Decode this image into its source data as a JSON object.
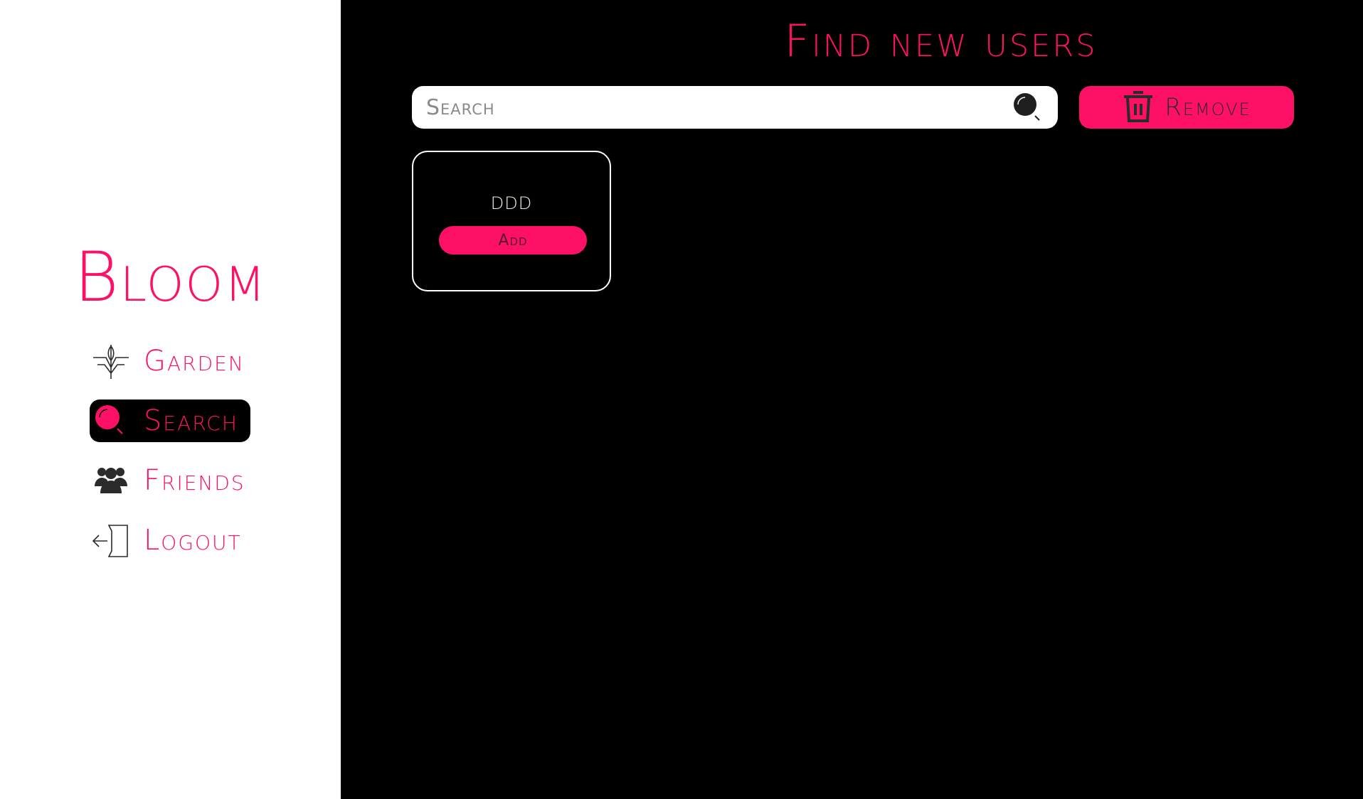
{
  "colors": {
    "accent": "#ff1067",
    "sidebar_bg": "#ffffff",
    "main_bg": "#000000",
    "icon_dark": "#2b2b2b"
  },
  "sidebar": {
    "brand": "Bloom",
    "items": [
      {
        "label": "Garden",
        "icon": "plant-icon",
        "active": false
      },
      {
        "label": "Search",
        "icon": "search-icon",
        "active": true
      },
      {
        "label": "Friends",
        "icon": "users-icon",
        "active": false
      },
      {
        "label": "Logout",
        "icon": "logout-icon",
        "active": false
      }
    ]
  },
  "main": {
    "title": "Find new users",
    "search": {
      "placeholder": "Search",
      "value": ""
    },
    "remove_label": "Remove",
    "results": [
      {
        "name": "DDD",
        "action_label": "Add"
      }
    ]
  }
}
